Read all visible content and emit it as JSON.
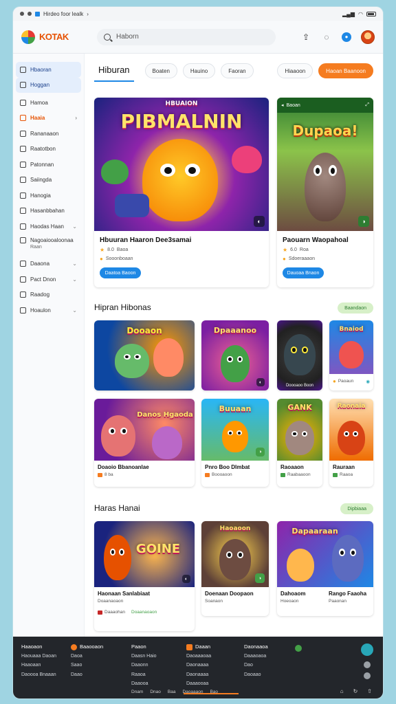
{
  "status": {
    "left_text": "Hirdeo foor lealk",
    "time": ""
  },
  "header": {
    "brand": "KOTAK",
    "search_placeholder": "Haborn"
  },
  "sidebar": {
    "items": [
      {
        "label": "Hbaoran",
        "sub": ""
      },
      {
        "label": "Hoggan",
        "sub": ""
      },
      {
        "label": "Hamoa",
        "sub": ""
      },
      {
        "label": "Haaia",
        "sub": ""
      },
      {
        "label": "Rananaaon",
        "sub": ""
      },
      {
        "label": "Raatotbon",
        "sub": ""
      },
      {
        "label": "Patonnan",
        "sub": ""
      },
      {
        "label": "Saiingda",
        "sub": ""
      },
      {
        "label": "Hanogia",
        "sub": ""
      },
      {
        "label": "Hasanbbahan",
        "sub": ""
      },
      {
        "label": "Haodas Haan",
        "sub": ""
      },
      {
        "label": "Nagoaiooaloonaa",
        "sub": "Raan"
      },
      {
        "label": "Daaona",
        "sub": ""
      },
      {
        "label": "Pact Dnon",
        "sub": ""
      },
      {
        "label": "Raadog",
        "sub": ""
      },
      {
        "label": "Hoaulon",
        "sub": ""
      }
    ]
  },
  "tabs": {
    "main": "Hiburan",
    "pills": [
      "Boaten",
      "Hauino",
      "Faoran"
    ],
    "right_pill": "Hiaaoon",
    "cta": "Haoan Baanoon"
  },
  "featured": [
    {
      "art_title": "PIBMALNIN",
      "art_sub": "HBUAION",
      "title": "Hbuuran Haaron Dee3samai",
      "rating": "8.0",
      "meta1": "Baoa",
      "meta2": "Sooonboaan",
      "button": "Daatoa Baoon"
    },
    {
      "art_title": "Dupaoa!",
      "art_sub": "Baoan",
      "title": "Paouarn Waopahoal",
      "rating": "6.0",
      "meta1": "Roa",
      "meta2": "Sdoeraaaon",
      "button": "Dauoaa Bnaon"
    }
  ],
  "section1": {
    "title": "Hipran Hibonas",
    "action": "Baandaon",
    "tiles": [
      {
        "art": "Dooaon",
        "title": "",
        "meta": ""
      },
      {
        "art": "Dpaaanoo",
        "title": "",
        "meta": ""
      },
      {
        "art": "",
        "title": "",
        "meta": "Doooaoo Boon"
      },
      {
        "art": "Bnaiod",
        "title": "",
        "meta": "Paoaun"
      },
      {
        "art": "Danos Hgaoda",
        "title": "Doaoio Bbanoanlae",
        "meta": "8 ba"
      },
      {
        "art": "Buuaan",
        "title": "Pnro Boo Dlmbat",
        "meta": "Boooaoon"
      },
      {
        "art": "GANK",
        "title": "Raoaaon",
        "meta": "Raabaaoon"
      },
      {
        "art": "Raonaia",
        "title": "Rauraan",
        "meta": "Raaoa"
      }
    ]
  },
  "section2": {
    "title": "Haras Hanai",
    "action": "Dipbiaaa",
    "tiles": [
      {
        "art": "GOINE",
        "title": "Haonaan Sanlabiaat",
        "meta": "Doaanaoaon",
        "meta2": "Daaaohan"
      },
      {
        "art": "Haoaoon",
        "title": "Doenaan Doopaon",
        "meta": "Soanaon"
      },
      {
        "art": "Dapaaraan",
        "title": "Dahoaom",
        "meta": "Hoeoaon",
        "title2": "Rango Faaoha",
        "meta2": "Paaonan"
      }
    ]
  },
  "footer": {
    "col1": [
      "Haaoaon",
      "Haouaaa Daoan",
      "Haaoaan",
      "Daoooa Bnaaan"
    ],
    "col2": [
      "Baaooaon",
      "Daoa",
      "Saao",
      "Daao"
    ],
    "col3": [
      "Paaon",
      "Daasn Haio",
      "Daaonn",
      "Raaoa",
      "Daaooa"
    ],
    "col4": [
      "Daaan",
      "Daoaaaoaa",
      "Daonaaaa",
      "Daonaaaa",
      "Daaaooaa"
    ],
    "col5": [
      "Daonaaoa",
      "Daaaoaoa",
      "Dao",
      "Daoaao"
    ],
    "bottom_links": [
      "Dnam",
      "Dnao",
      "Baa",
      "Daoaaaon",
      "Bao"
    ]
  },
  "colors": {
    "accent": "#f57c20",
    "primary": "#1e88e5",
    "footer": "#23262b"
  }
}
